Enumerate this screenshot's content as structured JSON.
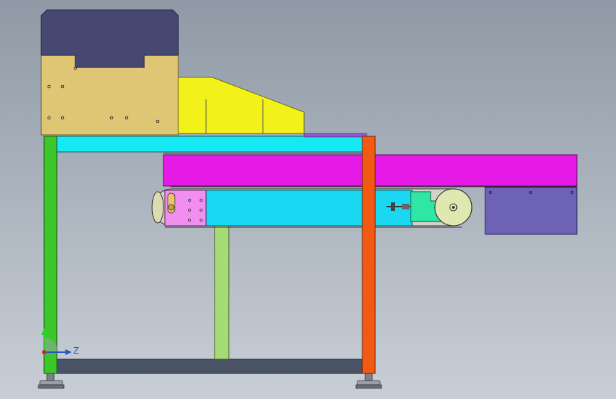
{
  "viewport": {
    "background_top": "#8f9aa6",
    "background_bottom": "#c9ced6"
  },
  "model": {
    "hopper_top_color": "#474872",
    "hopper_body_color": "#dfc675",
    "chute_color": "#f2f21a",
    "upper_rail_color": "#16e8f4",
    "belt_color": "#e61ae6",
    "lower_rail_color": "#1ad8f2",
    "drive_plate_color": "#f28ef0",
    "tensioner_color": "#2ee6a6",
    "side_box_color": "#6e62b6",
    "left_leg_color": "#3cc82a",
    "right_leg_color": "#f25a14",
    "middle_support_color": "#a6dc78",
    "base_beam_color": "#4a5266"
  },
  "triad": {
    "axis_z_label": "Z",
    "icon": "coordinate-triad-icon"
  }
}
